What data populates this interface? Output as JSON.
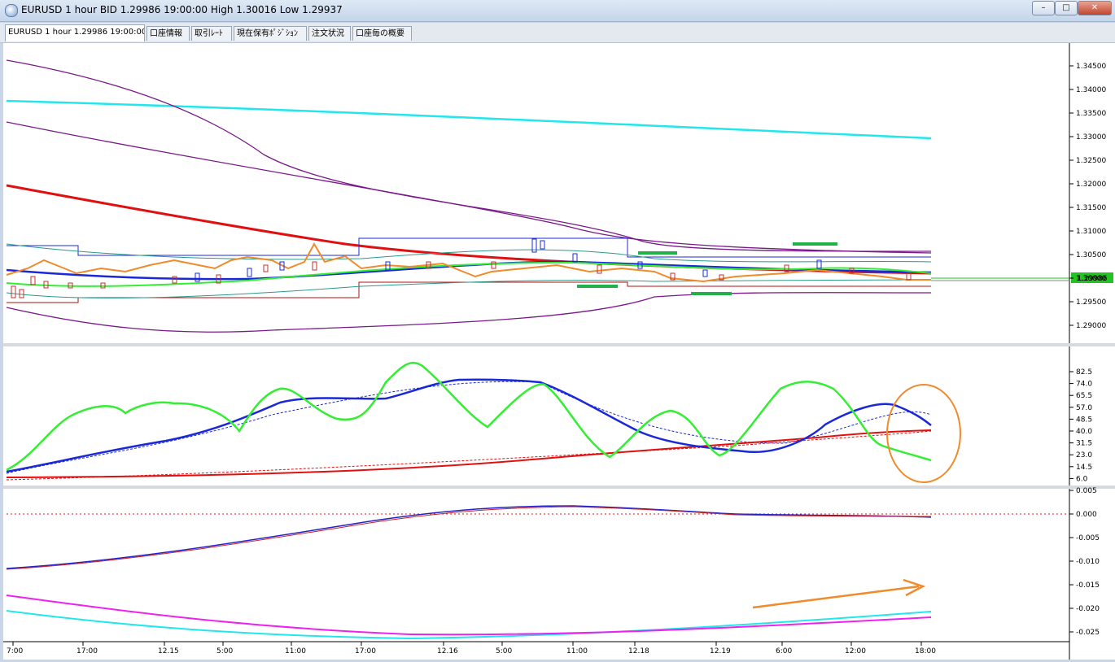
{
  "window": {
    "title": "EURUSD 1 hour BID 1.29986 19:00:00 High 1.30016 Low 1.29937",
    "minimize_label": "–",
    "maximize_label": "□",
    "close_label": "✕"
  },
  "tabs": [
    {
      "label": "EURUSD 1 hour 1.29986 19:00:00",
      "active": true
    },
    {
      "label": "口座情報"
    },
    {
      "label": "取引ﾚｰﾄ"
    },
    {
      "label": "現在保有ﾎﾟｼﾞｼｮﾝ"
    },
    {
      "label": "注文状況"
    },
    {
      "label": "口座毎の概要"
    }
  ],
  "price_panel": {
    "y_ticks": [
      "1.34500",
      "1.34000",
      "1.33500",
      "1.33000",
      "1.32500",
      "1.32000",
      "1.31500",
      "1.31000",
      "1.30500",
      "1.30000",
      "1.29500",
      "1.29000"
    ],
    "current_price_label": "1.29986",
    "current_price_color": "#22c322"
  },
  "oscillator_panel": {
    "y_ticks": [
      "82.5",
      "74.0",
      "65.5",
      "57.0",
      "48.5",
      "40.0",
      "31.5",
      "23.0",
      "14.5",
      "6.0"
    ],
    "colors": {
      "fast": "#33ee33",
      "medium": "#1a28d8",
      "slow": "#e01010"
    }
  },
  "macd_panel": {
    "y_ticks": [
      "0.005",
      "0.000",
      "-0.005",
      "-0.010",
      "-0.015",
      "-0.020",
      "-0.025"
    ],
    "colors": {
      "macd": "#2222cc",
      "signal": "#cc2222",
      "upper": "#22e6ee",
      "lower": "#ee22ee"
    }
  },
  "time_axis": [
    "7:00",
    "17:00",
    "12.15",
    "5:00",
    "11:00",
    "17:00",
    "12.16",
    "5:00",
    "11:00",
    "12.18",
    "12.19",
    "6:00",
    "12:00",
    "18:00"
  ],
  "annotations": {
    "circle_color": "#f08a2a",
    "arrow_color": "#f08a2a",
    "level_marker_color": "#22b04a"
  }
}
